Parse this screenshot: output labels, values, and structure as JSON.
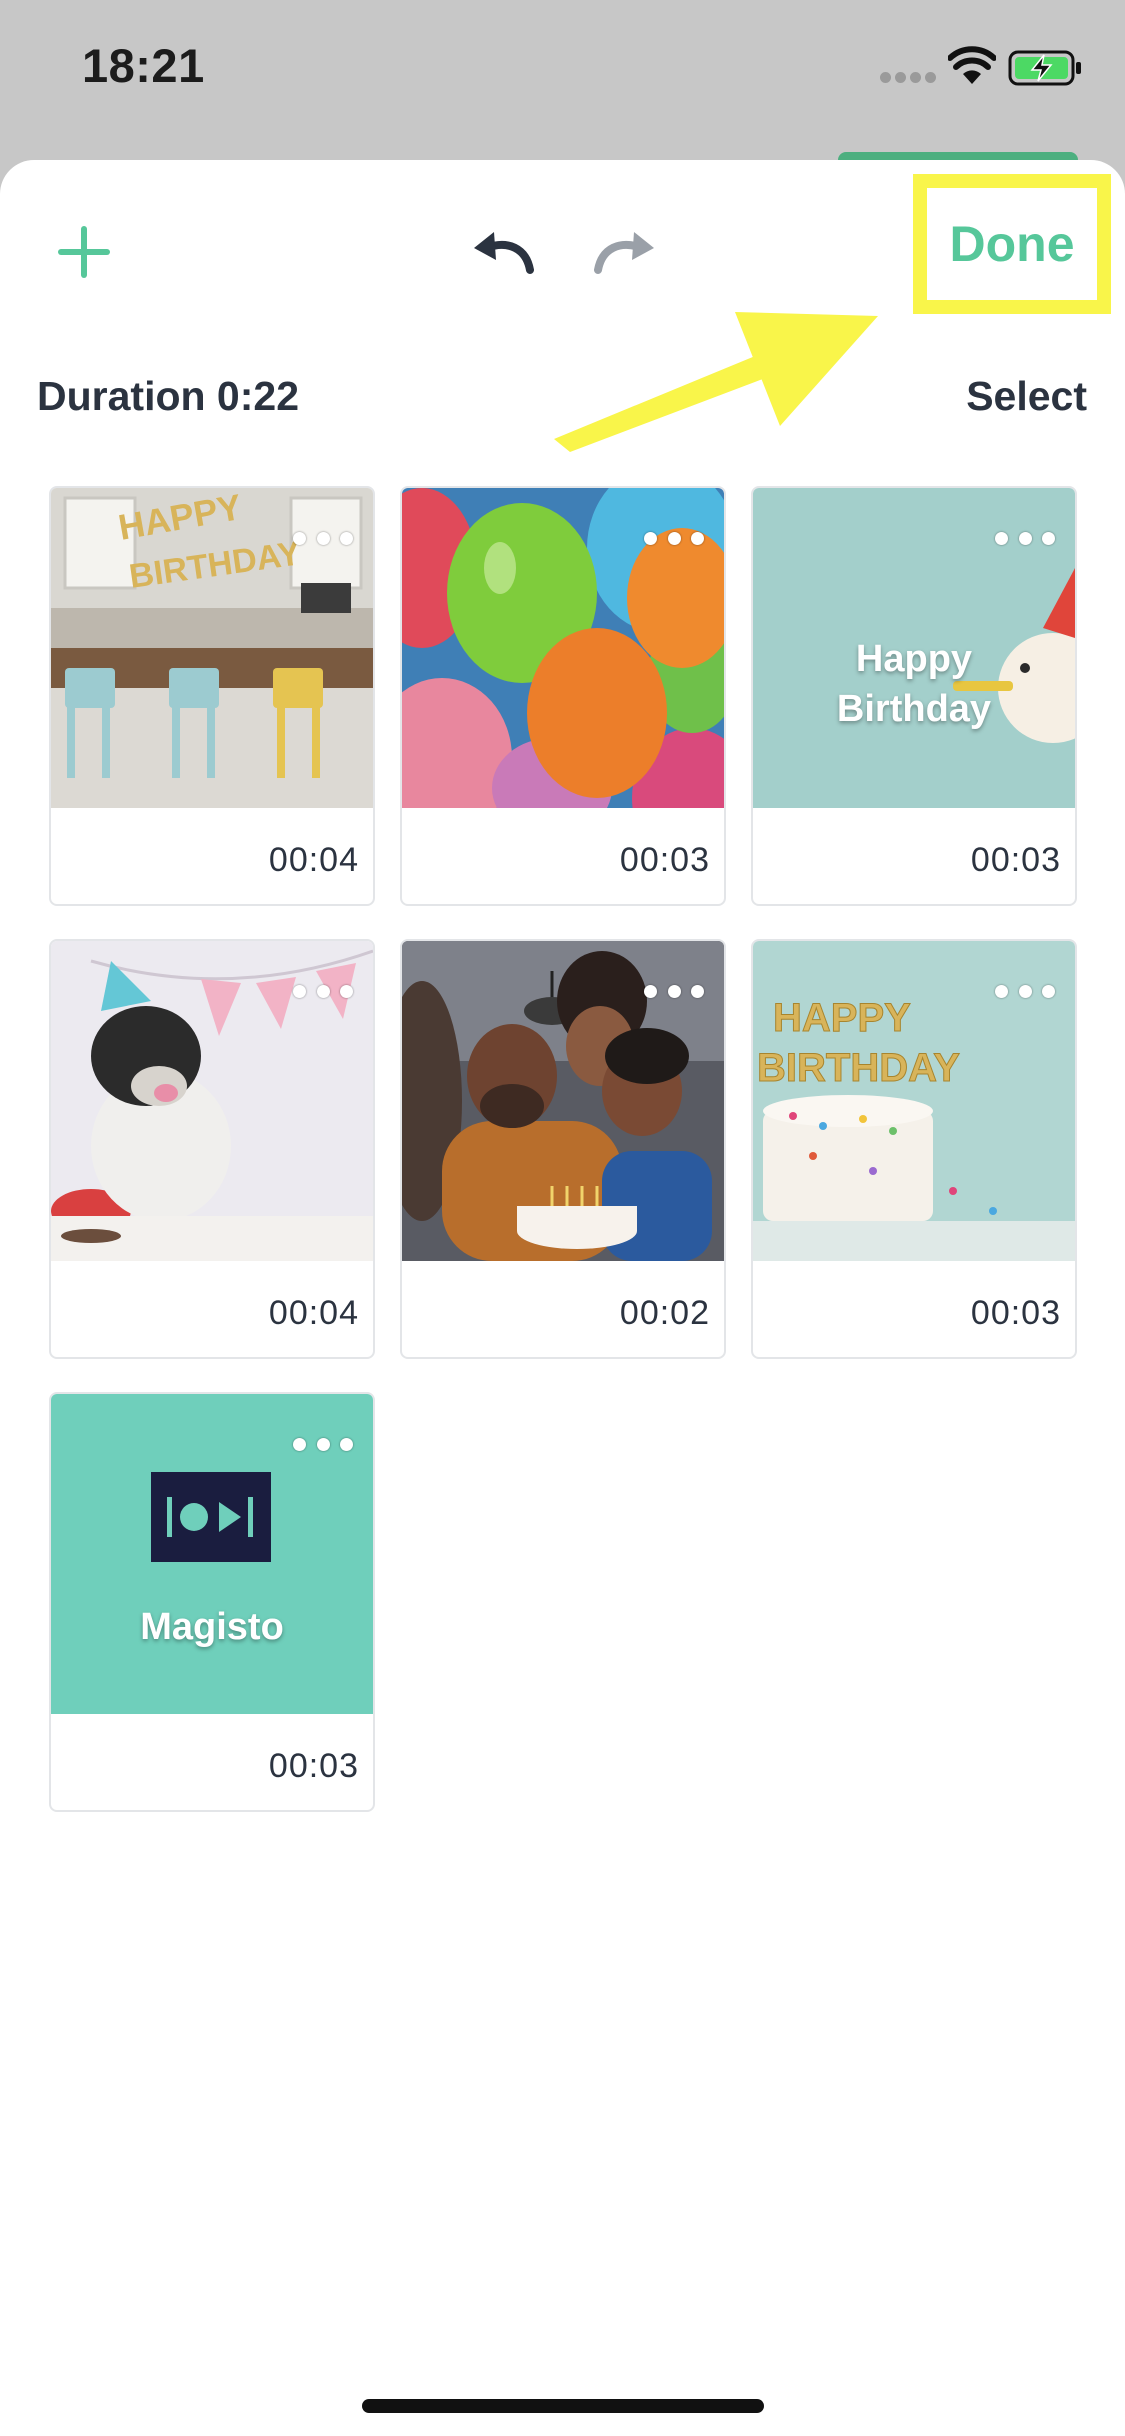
{
  "status_bar": {
    "time": "18:21",
    "icons": [
      "cellular-signal-icon",
      "wifi-icon",
      "battery-charging-icon"
    ]
  },
  "toolbar": {
    "add_icon": "plus-icon",
    "undo_icon": "undo-arrow-icon",
    "redo_icon": "redo-arrow-icon",
    "done_label": "Done"
  },
  "duration_label": "Duration 0:22",
  "select_label": "Select",
  "clips": [
    {
      "duration": "00:04",
      "thumb": "birthday-dining-room"
    },
    {
      "duration": "00:03",
      "thumb": "balloons"
    },
    {
      "duration": "00:03",
      "thumb": "happy-birthday-title-dog",
      "caption_line1": "Happy",
      "caption_line2": "Birthday"
    },
    {
      "duration": "00:04",
      "thumb": "bulldog-party-hat"
    },
    {
      "duration": "00:02",
      "thumb": "family-birthday-cake"
    },
    {
      "duration": "00:03",
      "thumb": "happy-birthday-cake"
    },
    {
      "duration": "00:03",
      "thumb": "magisto-logo",
      "caption": "Magisto"
    }
  ],
  "colors": {
    "accent": "#56c79a",
    "annotation_yellow": "#f9f54a",
    "text_dark": "#2b3340",
    "magisto_teal": "#6fcfbb",
    "magisto_logo_bg": "#1a1d3f"
  }
}
